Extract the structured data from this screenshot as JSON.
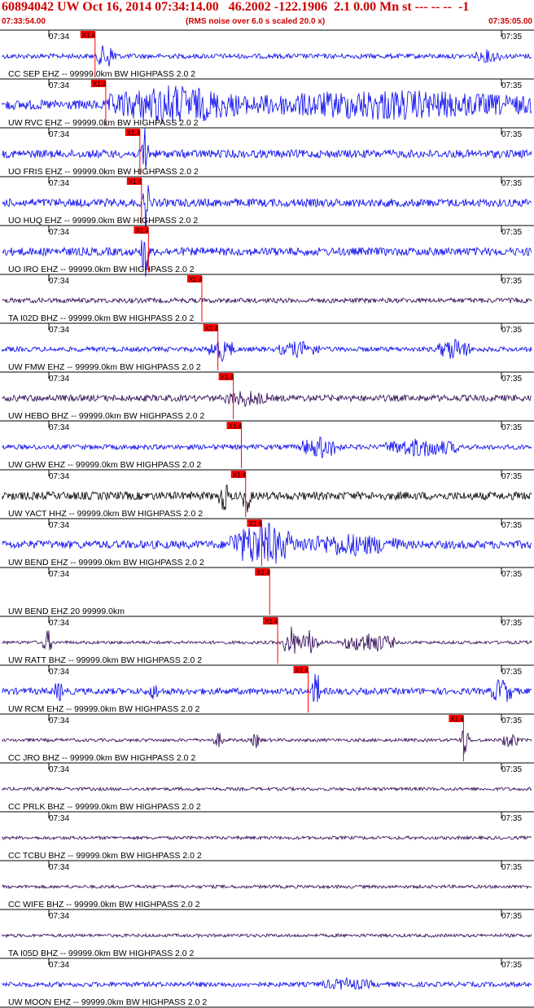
{
  "header": {
    "title": "60894042 UW Oct 16, 2014 07:34:14.00   46.2002 -122.1906  2.1 0.00 Mn st --- -- --  -1",
    "start_time": "07:33:54.00",
    "note": "(RMS noise over 6.0 s scaled 20.0 x)",
    "end_time": "07:35:05.00"
  },
  "chart_data": {
    "type": "line",
    "time_range": [
      "07:33:54.00",
      "07:35:05.00"
    ],
    "tick_labels": [
      "07:34",
      "07:35"
    ],
    "pick_label": "X1.4",
    "colors": {
      "blue": "#0000ee",
      "purple": "#2a0050",
      "black": "#000000",
      "pick": "#ff0000",
      "grid": "#000000",
      "title": "#cc0000"
    },
    "traces": [
      {
        "label": "CC SEP EHZ -- 99999.0km BW  HIGHPASS  2.0  2",
        "color": "blue",
        "amp": 3,
        "pick": 0.178,
        "bursts": [
          [
            0.18,
            0.22,
            14
          ],
          [
            0.89,
            0.94,
            6
          ]
        ]
      },
      {
        "label": "UW RVC EHZ -- 99999.0km BW  HIGHPASS  2.0  2",
        "color": "blue",
        "amp": 6,
        "pick": 0.198,
        "bursts": [
          [
            0.2,
            0.45,
            20
          ],
          [
            0.45,
            1.0,
            14
          ]
        ]
      },
      {
        "label": "UO FRIS EHZ -- 99999.0km BW  HIGHPASS  2.0  2",
        "color": "blue",
        "amp": 5,
        "pick": 0.262,
        "bursts": [
          [
            0.265,
            0.278,
            40
          ]
        ]
      },
      {
        "label": "UO HUQ EHZ -- 99999.0km BW  HIGHPASS  2.0  2",
        "color": "blue",
        "amp": 5,
        "pick": 0.265,
        "bursts": [
          [
            0.268,
            0.28,
            40
          ]
        ]
      },
      {
        "label": "UO IRO EHZ -- 99999.0km BW  HIGHPASS  2.0  2",
        "color": "blue",
        "amp": 5,
        "pick": 0.278,
        "bursts": [
          [
            0.265,
            0.28,
            40
          ]
        ]
      },
      {
        "label": "TA I02D BHZ -- 99999.0km BW  HIGHPASS  2.0  2",
        "color": "purple",
        "amp": 3,
        "pick": 0.378,
        "bursts": []
      },
      {
        "label": "UW FMW EHZ -- 99999.0km BW  HIGHPASS  2.0  2",
        "color": "blue",
        "amp": 3,
        "pick": 0.408,
        "bursts": [
          [
            0.39,
            0.44,
            12
          ],
          [
            0.52,
            0.6,
            8
          ],
          [
            0.82,
            0.88,
            12
          ]
        ]
      },
      {
        "label": "UW HEBO BHZ -- 99999.0km BW  HIGHPASS  2.0  2",
        "color": "purple",
        "amp": 4,
        "pick": 0.437,
        "bursts": [
          [
            0.42,
            0.5,
            7
          ]
        ]
      },
      {
        "label": "UW GHW EHZ -- 99999.0km BW  HIGHPASS  2.0  2",
        "color": "blue",
        "amp": 3,
        "pick": 0.452,
        "bursts": [
          [
            0.56,
            0.64,
            12
          ],
          [
            0.72,
            0.86,
            10
          ]
        ]
      },
      {
        "label": "UW YACT HHZ -- 99999.0km BW  HIGHPASS  2.0  2",
        "color": "black",
        "amp": 5,
        "pick": 0.46,
        "bursts": [
          [
            0.41,
            0.43,
            16
          ],
          [
            0.455,
            0.47,
            20
          ]
        ]
      },
      {
        "label": "UW BEND EHZ -- 99999.0km BW  HIGHPASS  2.0  2",
        "color": "blue",
        "amp": 5,
        "pick": 0.49,
        "bursts": [
          [
            0.43,
            0.55,
            26
          ],
          [
            0.55,
            0.75,
            10
          ]
        ]
      },
      {
        "label": "UW BEND EHZ 20 99999.0km",
        "color": "blue",
        "amp": 0,
        "pick": 0.505,
        "bursts": []
      },
      {
        "label": "UW RATT BHZ -- 99999.0km BW  HIGHPASS  2.0  2",
        "color": "purple",
        "amp": 2,
        "pick": 0.52,
        "bursts": [
          [
            0.08,
            0.1,
            14
          ],
          [
            0.53,
            0.56,
            20
          ],
          [
            0.56,
            0.6,
            14
          ],
          [
            0.64,
            0.74,
            12
          ]
        ]
      },
      {
        "label": "UW RCM EHZ -- 99999.0km BW  HIGHPASS  2.0  2",
        "color": "blue",
        "amp": 4,
        "pick": 0.577,
        "bursts": [
          [
            0.1,
            0.12,
            10
          ],
          [
            0.28,
            0.3,
            8
          ],
          [
            0.585,
            0.6,
            24
          ],
          [
            0.92,
            0.96,
            14
          ]
        ]
      },
      {
        "label": "CC JRO BHZ -- 99999.0km BW  HIGHPASS  2.0  2",
        "color": "purple",
        "amp": 2,
        "pick": 0.868,
        "bursts": [
          [
            0.4,
            0.42,
            8
          ],
          [
            0.47,
            0.49,
            8
          ],
          [
            0.86,
            0.88,
            18
          ],
          [
            0.94,
            0.97,
            10
          ]
        ]
      },
      {
        "label": "CC PRLK BHZ -- 99999.0km BW  HIGHPASS  2.0  2",
        "color": "purple",
        "amp": 2,
        "pick": null,
        "bursts": []
      },
      {
        "label": "CC TCBU BHZ -- 99999.0km BW  HIGHPASS  2.0  2",
        "color": "purple",
        "amp": 2,
        "pick": null,
        "bursts": []
      },
      {
        "label": "CC WIFE BHZ -- 99999.0km BW  HIGHPASS  2.0  2",
        "color": "purple",
        "amp": 2,
        "pick": null,
        "bursts": []
      },
      {
        "label": "TA I05D BHZ -- 99999.0km BW  HIGHPASS  2.0  2",
        "color": "purple",
        "amp": 2,
        "pick": null,
        "bursts": []
      },
      {
        "label": "UW MOON EHZ -- 99999.0km BW  HIGHPASS  2.0  2",
        "color": "blue",
        "amp": 3,
        "pick": null,
        "bursts": [
          [
            0.6,
            0.7,
            5
          ]
        ]
      }
    ]
  }
}
